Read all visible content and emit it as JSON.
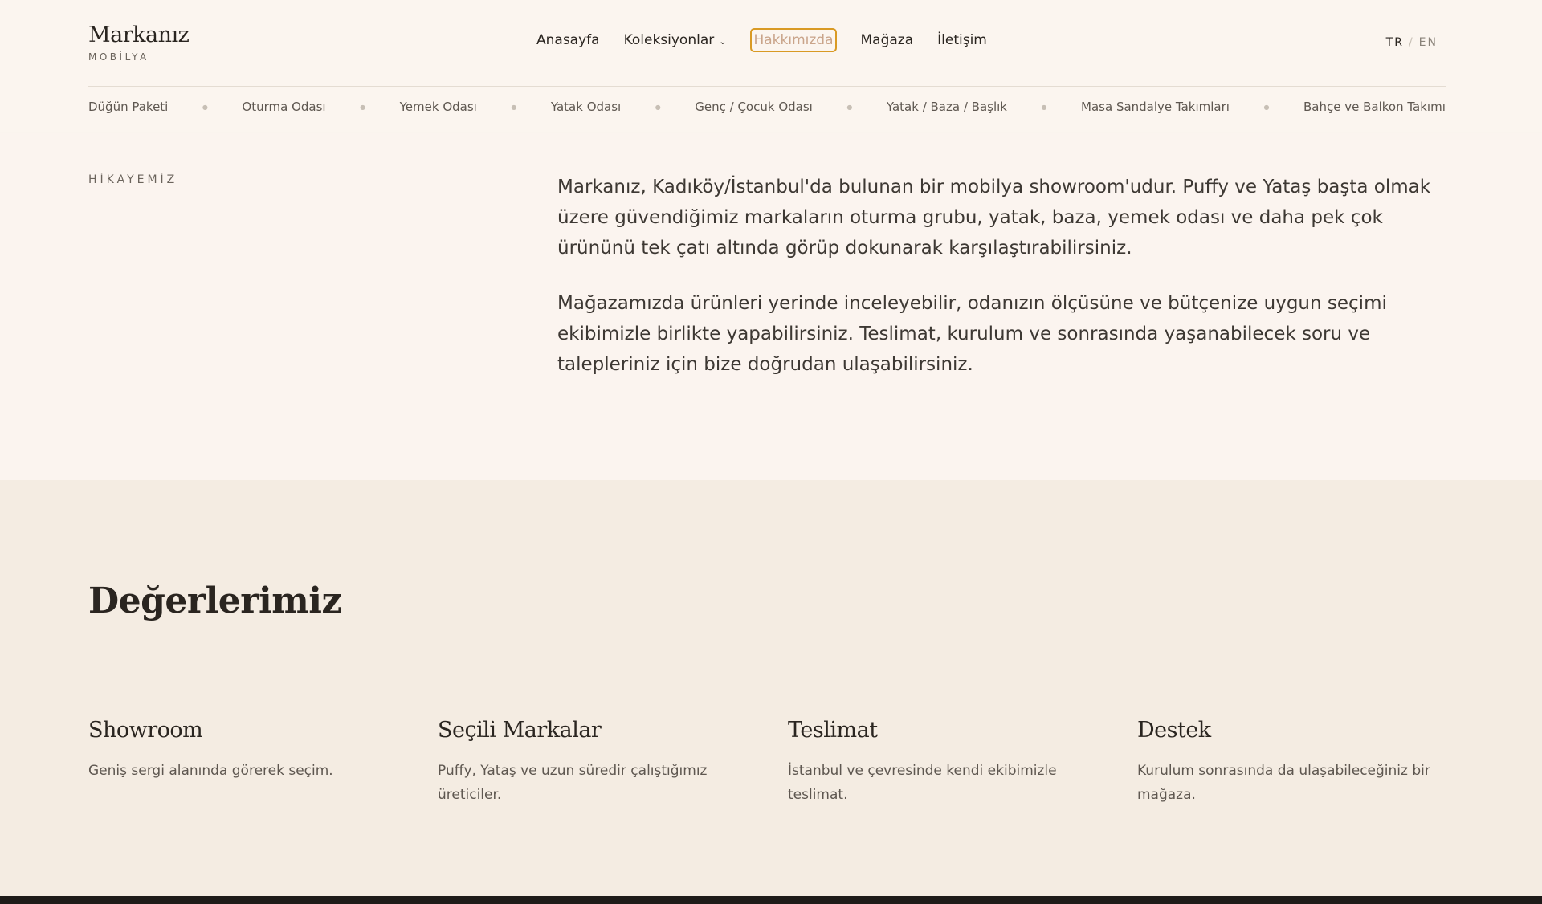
{
  "brand": {
    "name": "Markanız",
    "subtitle": "MOBİLYA"
  },
  "main_nav": {
    "home": "Anasayfa",
    "collections": "Koleksiyonlar",
    "about": "Hakkımızda",
    "store": "Mağaza",
    "contact": "İletişim"
  },
  "lang": {
    "tr": "TR",
    "sep": "/",
    "en": "EN"
  },
  "categories": [
    "Düğün Paketi",
    "Oturma Odası",
    "Yemek Odası",
    "Yatak Odası",
    "Genç / Çocuk Odası",
    "Yatak / Baza / Başlık",
    "Masa Sandalye Takımları",
    "Bahçe ve Balkon Takımı"
  ],
  "story": {
    "label": "HİKAYEMİZ",
    "paragraphs": [
      "Markanız, Kadıköy/İstanbul'da bulunan bir mobilya showroom'udur. Puffy ve Yataş başta olmak üzere güvendiğimiz markaların oturma grubu, yatak, baza, yemek odası ve daha pek çok ürününü tek çatı altında görüp dokunarak karşılaştırabilirsiniz.",
      "Mağazamızda ürünleri yerinde inceleyebilir, odanızın ölçüsüne ve bütçenize uygun seçimi ekibimizle birlikte yapabilirsiniz. Teslimat, kurulum ve sonrasında yaşanabilecek soru ve talepleriniz için bize doğrudan ulaşabilirsiniz."
    ]
  },
  "values": {
    "title": "Değerlerimiz",
    "items": [
      {
        "title": "Showroom",
        "desc": "Geniş sergi alanında görerek seçim."
      },
      {
        "title": "Seçili Markalar",
        "desc": "Puffy, Yataş ve uzun süredir çalıştığımız üreticiler."
      },
      {
        "title": "Teslimat",
        "desc": "İstanbul ve çevresinde kendi ekibimizle teslimat."
      },
      {
        "title": "Destek",
        "desc": "Kurulum sonrasında da ulaşabileceğiniz bir mağaza."
      }
    ]
  },
  "colors": {
    "accent_focus": "#d99a24",
    "background": "#faf4ee",
    "values_bg": "#f4ece2"
  }
}
